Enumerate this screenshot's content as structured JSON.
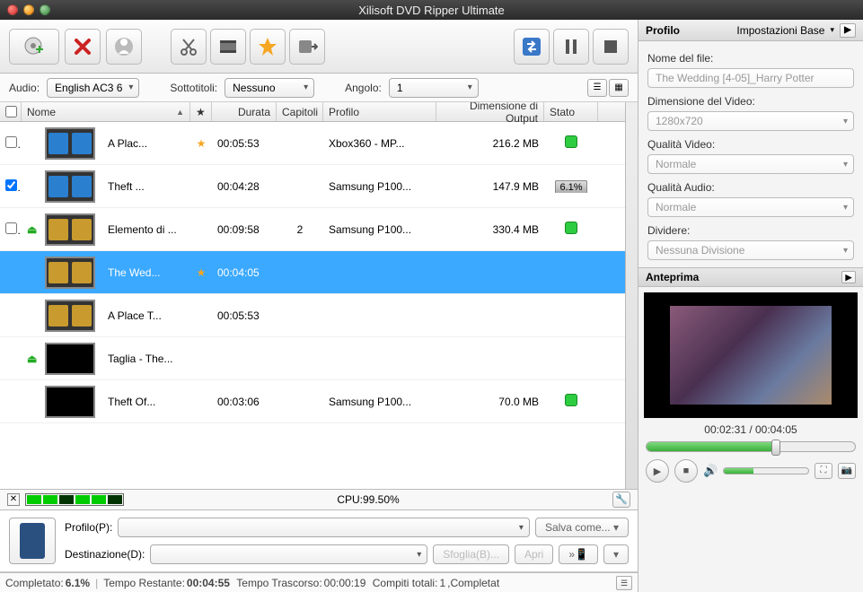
{
  "window_title": "Xilisoft DVD Ripper Ultimate",
  "options": {
    "audio_label": "Audio:",
    "audio_value": "English AC3 6",
    "subtitle_label": "Sottotitoli:",
    "subtitle_value": "Nessuno",
    "angle_label": "Angolo:",
    "angle_value": "1"
  },
  "columns": {
    "name": "Nome",
    "star": "★",
    "duration": "Durata",
    "chapters": "Capitoli",
    "profile": "Profilo",
    "output": "Dimensione di Output",
    "status": "Stato"
  },
  "rows": [
    {
      "checked": false,
      "thumb": "blue",
      "name": "A Plac...",
      "star": true,
      "duration": "00:05:53",
      "chapters": "",
      "profile": "Xbox360 - MP...",
      "output": "216.2 MB",
      "status": "dot"
    },
    {
      "checked": true,
      "thumb": "blue",
      "name": "Theft ...",
      "star": false,
      "duration": "00:04:28",
      "chapters": "",
      "profile": "Samsung P100...",
      "output": "147.9 MB",
      "status": "6.1%"
    },
    {
      "checked": false,
      "eject": true,
      "thumb": "yellow",
      "name": "Elemento di ...",
      "star": false,
      "duration": "00:09:58",
      "chapters": "2",
      "profile": "Samsung P100...",
      "output": "330.4 MB",
      "status": "dot"
    },
    {
      "selected": true,
      "thumb": "yellow",
      "name": "The Wed...",
      "star": true,
      "duration": "00:04:05",
      "chapters": "",
      "profile": "",
      "output": "",
      "status": ""
    },
    {
      "thumb": "yellow",
      "name": "A Place T...",
      "star": false,
      "duration": "00:05:53",
      "chapters": "",
      "profile": "",
      "output": "",
      "status": ""
    },
    {
      "eject": true,
      "thumb": "black",
      "name": "Taglia - The...",
      "star": false,
      "duration": "",
      "chapters": "",
      "profile": "",
      "output": "",
      "status": ""
    },
    {
      "thumb": "black",
      "name": "Theft Of...",
      "star": false,
      "duration": "00:03:06",
      "chapters": "",
      "profile": "Samsung P100...",
      "output": "70.0 MB",
      "status": "dot"
    }
  ],
  "cpu": {
    "label": "CPU:99.50%"
  },
  "profile_section": {
    "profile_label": "Profilo(P):",
    "dest_label": "Destinazione(D):",
    "save_as": "Salva come...",
    "browse": "Sfoglia(B)...",
    "open": "Apri"
  },
  "statusbar": {
    "completed_label": "Completato:",
    "completed_value": "6.1%",
    "remaining_label": "Tempo Restante:",
    "remaining_value": "00:04:55",
    "elapsed_label": "Tempo Trascorso:",
    "elapsed_value": "00:00:19",
    "tasks_label": "Compiti totali:",
    "tasks_value": "1",
    "tasks_suffix": ",Completat"
  },
  "right": {
    "tab_profile": "Profilo",
    "tab_settings": "Impostazioni Base",
    "filename_label": "Nome del file:",
    "filename_value": "The Wedding [4-05]_Harry Potter",
    "video_dim_label": "Dimensione del Video:",
    "video_dim_value": "1280x720",
    "video_q_label": "Qualità Video:",
    "video_q_value": "Normale",
    "audio_q_label": "Qualità Audio:",
    "audio_q_value": "Normale",
    "split_label": "Dividere:",
    "split_value": "Nessuna Divisione",
    "preview_label": "Anteprima",
    "time": "00:02:31 / 00:04:05"
  }
}
